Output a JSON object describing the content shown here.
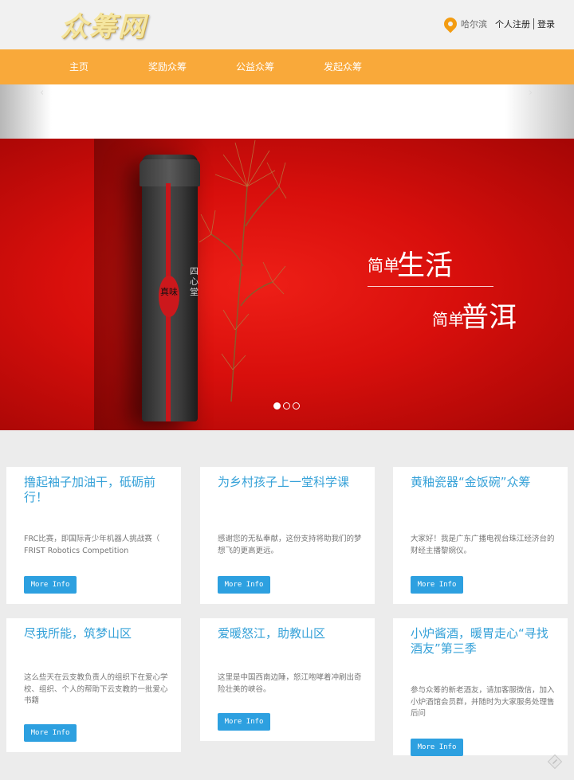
{
  "header": {
    "logo": "众筹网",
    "city": "哈尔滨",
    "register": "个人注册",
    "login": "登录"
  },
  "nav": {
    "items": [
      "主页",
      "奖励众筹",
      "公益众筹",
      "发起众筹"
    ]
  },
  "carousel": {
    "prev": "‹",
    "next": "›",
    "slide_count": 3,
    "active_slide": 1
  },
  "banner": {
    "tin_seal": "真味",
    "tin_label": "四心堂",
    "slogan_small_1": "简单",
    "slogan_big_1": "生活",
    "slogan_small_2": "简单",
    "slogan_big_2": "普洱"
  },
  "cards": [
    {
      "title": "撸起袖子加油干，砥砺前行！",
      "desc": "FRC比赛，即国际青少年机器人挑战赛（ FRIST Robotics Competition",
      "button": "More Info"
    },
    {
      "title": "为乡村孩子上一堂科学课",
      "desc": "感谢您的无私奉献，这份支持将助我们的梦想飞的更高更远。",
      "button": "More Info"
    },
    {
      "title": "黄釉瓷器“金饭碗”众筹",
      "desc": "大家好！我是广东广播电视台珠江经济台的财经主播黎婉仪。",
      "button": "More Info"
    },
    {
      "title": "尽我所能，筑梦山区",
      "desc": "这么些天在云支教负责人的组织下在爱心学校、组织、个人的帮助下云支教的一批爱心书籍",
      "button": "More Info"
    },
    {
      "title": "爱暖怒江，助教山区",
      "desc": "这里是中国西南边陲，怒江咆哮着冲刷出奇险壮美的峡谷。",
      "button": "More Info"
    },
    {
      "title": "小炉酱酒，暖胃走心“寻找酒友”第三季",
      "desc": "参与众筹的新老酒友，请加客服微信，加入小炉酒馆会员群，并随时为大家服务处理售后问",
      "button": "More Info"
    }
  ]
}
